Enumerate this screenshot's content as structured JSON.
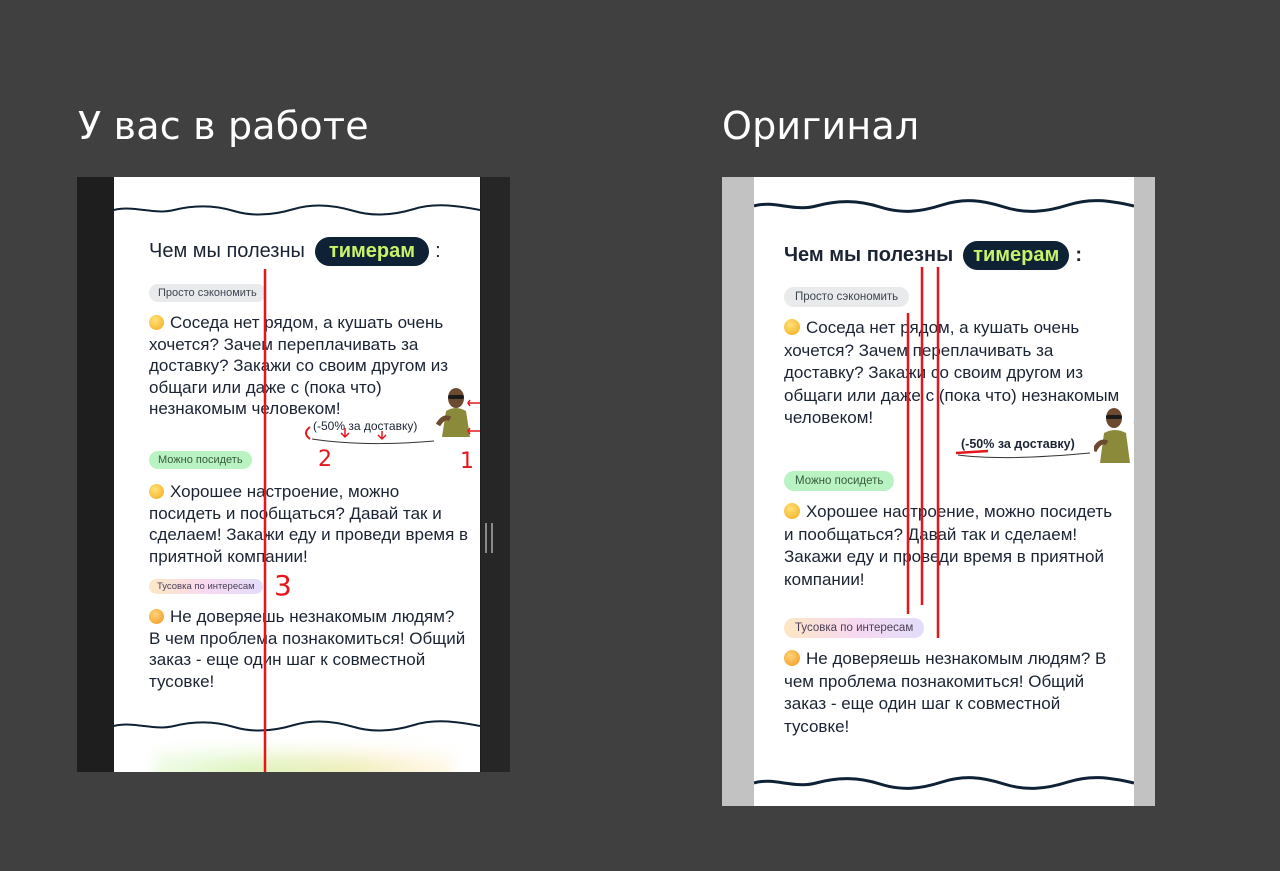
{
  "headings": {
    "left": "У вас в работе",
    "right": "Оригинал"
  },
  "card": {
    "title_prefix": "Чем мы полезны",
    "title_highlight": "тимерам",
    "title_suffix": ":",
    "sections": [
      {
        "tag": "Просто сэкономить",
        "emoji": "smirk-emoji-icon",
        "text": "Соседа нет рядом, а кушать очень хочется? Зачем переплачивать за доставку? Закажи со своим другом из общаги или даже с (пока что) незнакомым человеком!"
      },
      {
        "tag": "Можно посидеть",
        "emoji": "smile-emoji-icon",
        "text": "Хорошее настроение, можно посидеть и пообщаться? Давай так и сделаем! Закажи еду и проведи время в приятной компании!"
      },
      {
        "tag": "Тусовка по интересам",
        "emoji": "party-emoji-icon",
        "text": "Не доверяешь незнакомым людям? В чем проблема познакомиться! Общий заказ - еще один шаг к совместной тусовке!"
      }
    ],
    "discount": "(-50% за доставку)"
  },
  "annotations": {
    "n1": "1",
    "n2": "2",
    "n3": "3"
  },
  "colors": {
    "pill_bg": "#0f2235",
    "pill_text": "#c8f26a",
    "markup_red": "#e4161b",
    "wave": "#0f2235"
  }
}
